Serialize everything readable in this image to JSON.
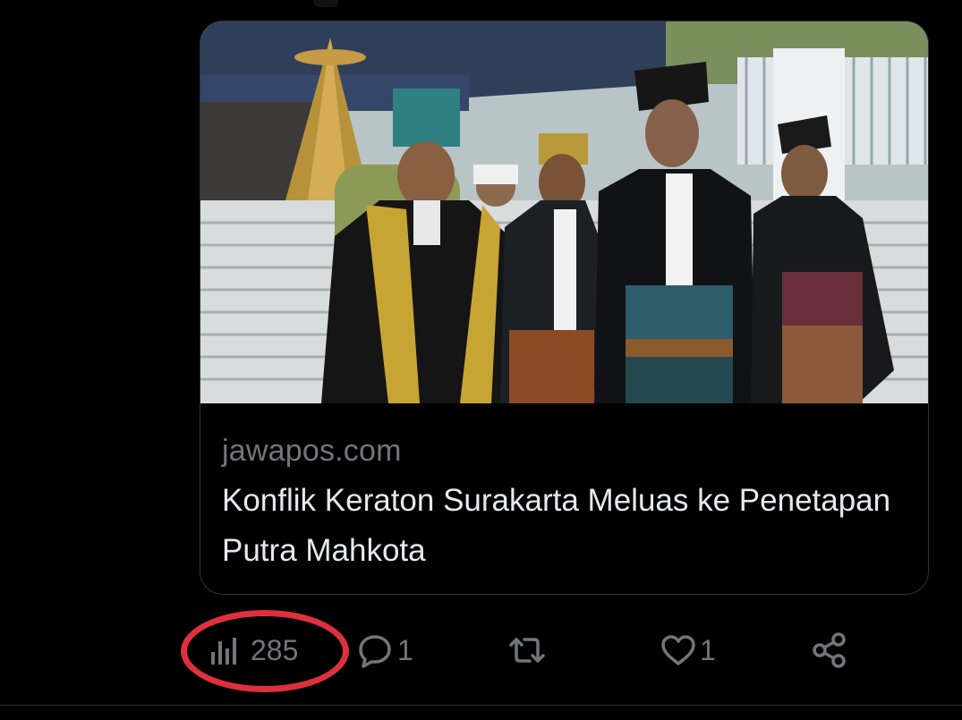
{
  "card": {
    "domain": "jawapos.com",
    "title": "Konflik Keraton Surakarta Meluas ke Penetapan Putra Mahkota"
  },
  "actions": {
    "views": {
      "icon": "bar-chart-icon",
      "count": "285"
    },
    "replies": {
      "icon": "reply-bubble-icon",
      "count": "1"
    },
    "retweets": {
      "icon": "retweet-icon",
      "count": ""
    },
    "likes": {
      "icon": "heart-icon",
      "count": "1"
    },
    "share": {
      "icon": "share-icon"
    }
  },
  "colors": {
    "background": "#000000",
    "text_primary": "#e7e9ea",
    "text_secondary": "#71767b",
    "border": "#2f3336",
    "highlight": "#e0303c"
  }
}
